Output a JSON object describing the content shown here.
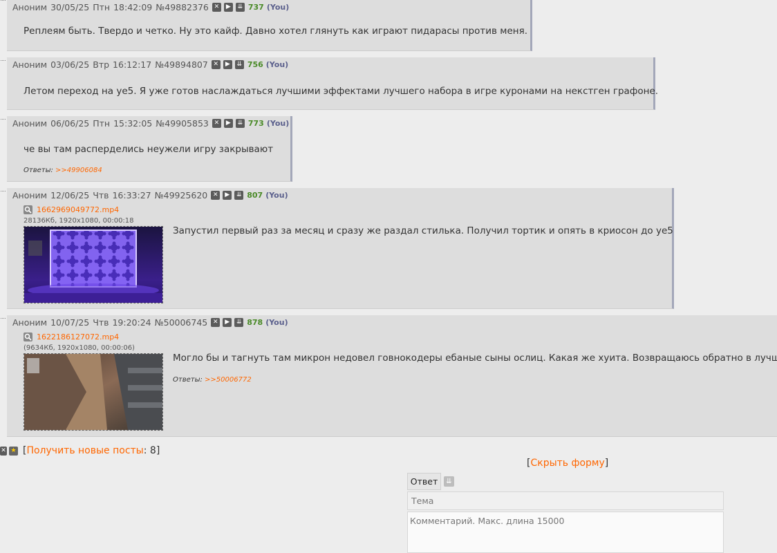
{
  "posts": [
    {
      "name": "Аноним",
      "date": "30/05/25",
      "day": "Птн",
      "time": "18:42:09",
      "id": "№49882376",
      "num": "737",
      "you": "(You)",
      "message": "Реплеям быть. Твердо и четко. Ну это кайф. Давно хотел глянуть как играют пидарасы против меня."
    },
    {
      "name": "Аноним",
      "date": "03/06/25",
      "day": "Втр",
      "time": "16:12:17",
      "id": "№49894807",
      "num": "756",
      "you": "(You)",
      "message": "Летом переход на уе5. Я уже готов наслаждаться лучшими эффектами лучшего набора в игре куронами на некстген графоне."
    },
    {
      "name": "Аноним",
      "date": "06/06/25",
      "day": "Птн",
      "time": "15:32:05",
      "id": "№49905853",
      "num": "773",
      "you": "(You)",
      "message": "че вы там расперделись неужели игру закрывают",
      "replies_label": "Ответы:",
      "replies": ">>49906084"
    },
    {
      "name": "Аноним",
      "date": "12/06/25",
      "day": "Чтв",
      "time": "16:33:27",
      "id": "№49925620",
      "num": "807",
      "you": "(You)",
      "file_name": "1662969049772.mp4",
      "file_meta": "28136Кб, 1920x1080, 00:00:18",
      "message": "Запустил первый раз за месяц и сразу же раздал стилька. Получил тортик и опять в криосон до уе5"
    },
    {
      "name": "Аноним",
      "date": "10/07/25",
      "day": "Чтв",
      "time": "19:20:24",
      "id": "№50006745",
      "num": "878",
      "you": "(You)",
      "file_name": "1622186127072.mp4",
      "file_meta": "(9634Кб, 1920x1080, 00:00:06)",
      "message": "Могло бы и тагнуть там микрон недовел говнокодеры ебаные сыны ослиц. Какая же хуита. Возвращаюсь обратно в лучшую и",
      "replies_label": "Ответы:",
      "replies": ">>50006772"
    }
  ],
  "footer": {
    "new_posts_label": "Получить новые посты",
    "new_posts_count": "8",
    "hide_form": "Скрыть форму"
  },
  "form": {
    "tab_reply": "Ответ",
    "subject_placeholder": "Тема",
    "comment_placeholder": "Комментарий. Макс. длина 15000"
  },
  "colors": {
    "link": "#ff6600",
    "post_bg": "#dddddd",
    "num": "#4a8a28",
    "you": "#5a5f8c"
  }
}
